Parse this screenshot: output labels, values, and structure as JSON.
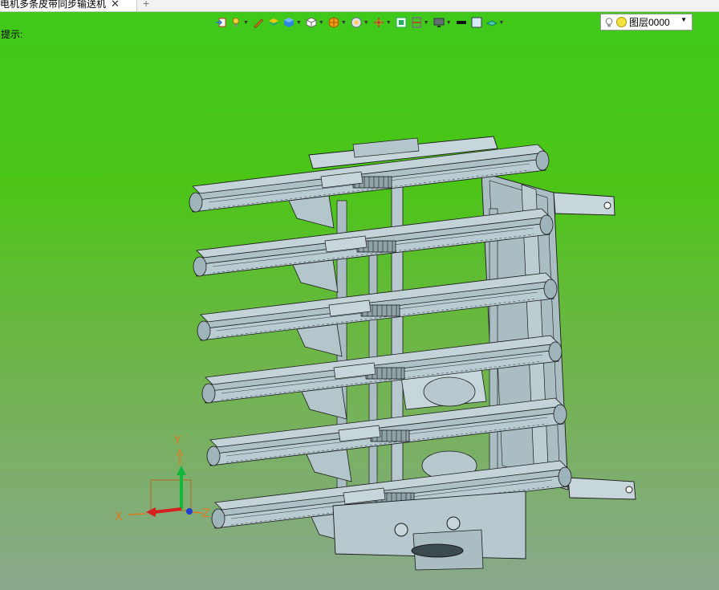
{
  "tabs": {
    "document_title": "电机多条皮带同步输送机",
    "close_glyph": "✕",
    "new_tab_glyph": "+"
  },
  "hint": {
    "label": "提示:"
  },
  "toolbar": {
    "items": [
      {
        "icon": "import-icon",
        "dropdown": false
      },
      {
        "icon": "light-bulb-tool-icon",
        "dropdown": true
      },
      {
        "icon": "pen-icon",
        "dropdown": false
      },
      {
        "icon": "layers-stack-icon",
        "dropdown": false
      },
      {
        "icon": "blue-cube-icon",
        "dropdown": true
      },
      {
        "icon": "white-cube-icon",
        "dropdown": true
      },
      {
        "icon": "render-sphere-icon",
        "dropdown": true
      },
      {
        "icon": "measure-circle-icon",
        "dropdown": true
      },
      {
        "icon": "orient-axes-icon",
        "dropdown": true
      },
      {
        "icon": "fit-view-icon",
        "dropdown": false
      },
      {
        "icon": "section-view-icon",
        "dropdown": true
      },
      {
        "icon": "monitor-icon",
        "dropdown": true
      },
      {
        "icon": "line-color-icon",
        "dropdown": false
      },
      {
        "icon": "fill-color-icon",
        "dropdown": false
      },
      {
        "icon": "display-mode-icon",
        "dropdown": true
      }
    ]
  },
  "layer": {
    "name": "图层0000",
    "color": "#f5e23a"
  },
  "triad": {
    "x": "X",
    "y": "Y",
    "z": "Z"
  },
  "colors": {
    "viewport_top": "#3fc81a",
    "viewport_bottom": "#8aa88c",
    "part": "#b7c9cf",
    "edge": "#1a1a1a",
    "triad_label": "#e0781e"
  }
}
